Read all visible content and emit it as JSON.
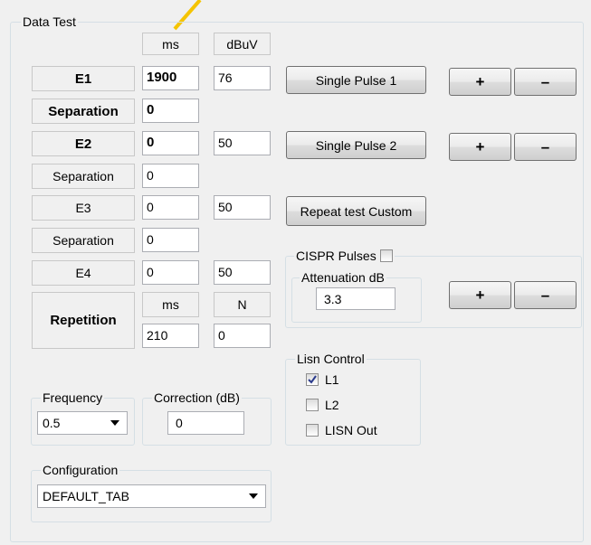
{
  "data_test": {
    "title": "Data Test",
    "col_ms": "ms",
    "col_dbuv": "dBuV",
    "e1": {
      "label": "E1",
      "ms": "1900",
      "dbuv": "76"
    },
    "sep1": {
      "label": "Separation",
      "ms": "0"
    },
    "e2": {
      "label": "E2",
      "ms": "0",
      "dbuv": "50"
    },
    "sep2": {
      "label": "Separation",
      "ms": "0"
    },
    "e3": {
      "label": "E3",
      "ms": "0",
      "dbuv": "50"
    },
    "sep3": {
      "label": "Separation",
      "ms": "0"
    },
    "e4": {
      "label": "E4",
      "ms": "0",
      "dbuv": "50"
    },
    "repetition": {
      "label": "Repetition",
      "col_ms": "ms",
      "col_n": "N",
      "ms": "210",
      "n": "0"
    },
    "buttons": {
      "single_pulse_1": "Single Pulse 1",
      "single_pulse_2": "Single Pulse 2",
      "repeat_custom": "Repeat test Custom",
      "plus": "+",
      "minus": "–"
    },
    "cispr": {
      "title": "CISPR Pulses",
      "checked": false,
      "attenuation_title": "Attenuation dB",
      "attenuation": "3.3"
    },
    "lisn": {
      "title": "Lisn Control",
      "l1": "L1",
      "l1_checked": true,
      "l2": "L2",
      "l2_checked": false,
      "out": "LISN Out",
      "out_checked": false
    },
    "frequency": {
      "title": "Frequency",
      "value": "0.5"
    },
    "correction": {
      "title": "Correction (dB)",
      "value": "0"
    },
    "configuration": {
      "title": "Configuration",
      "value": "DEFAULT_TAB"
    },
    "accent_color": "#f5c400"
  }
}
